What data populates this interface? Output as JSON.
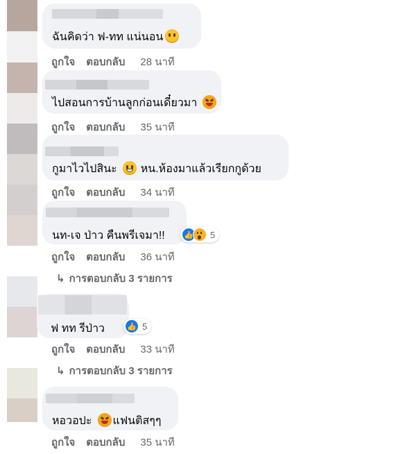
{
  "colors": {
    "bubble_bg": "#f0f2f5",
    "action_text": "#65676b",
    "like_blue": "#1877f2"
  },
  "comments": [
    {
      "text": "ฉันคิดว่า ฟ-ทท แน่นอน",
      "emoji": "thinking-face-icon",
      "like_label": "ถูกใจ",
      "reply_label": "ตอบกลับ",
      "time": "28 นาที"
    },
    {
      "text": "ไปสอนการบ้านลูกก่อนเดี๋ยวมา",
      "emoji": "squinting-tongue-face-icon",
      "like_label": "ถูกใจ",
      "reply_label": "ตอบกลับ",
      "time": "35 นาที"
    },
    {
      "text_before": "กูมาไวไปสินะ",
      "emoji": "grinning-sweat-face-icon",
      "text_after": "หน.ห้องมาแล้วเรียกกูด้วย",
      "like_label": "ถูกใจ",
      "reply_label": "ตอบกลับ",
      "time": "34 นาที"
    },
    {
      "text": "นท-เจ ป่าว คืนพรีเจมา!!",
      "reactions": [
        "like-icon",
        "wow-icon"
      ],
      "reaction_count": "5",
      "like_label": "ถูกใจ",
      "reply_label": "ตอบกลับ",
      "time": "36 นาที",
      "replies_label": "การตอบกลับ 3 รายการ"
    },
    {
      "text": "ฟ ทท รีป่าว",
      "reactions": [
        "like-icon"
      ],
      "reaction_count": "5",
      "like_label": "ถูกใจ",
      "reply_label": "ตอบกลับ",
      "time": "33 นาที",
      "replies_label": "การตอบกลับ 3 รายการ"
    },
    {
      "text_before": "หอวอปะ",
      "emoji": "squinting-tongue-face-icon",
      "text_after": "แฟนติสๆๆ",
      "like_label": "ถูกใจ",
      "reply_label": "ตอบกลับ",
      "time": "35 นาที"
    }
  ]
}
